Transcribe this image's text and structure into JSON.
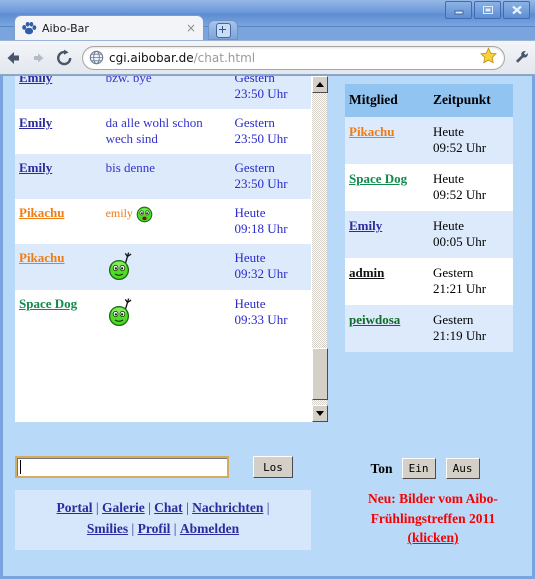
{
  "window": {
    "controls": {
      "minimize": "minimize",
      "maximize": "maximize",
      "close": "close"
    }
  },
  "browser": {
    "tab": {
      "title": "Aibo-Bar",
      "favicon": "paw-print-icon",
      "close_label": "×"
    },
    "new_tab_label": "+",
    "toolbar": {
      "back": "back-arrow-icon",
      "forward": "forward-arrow-icon",
      "reload": "reload-icon",
      "url_host": "cgi.aibobar.de",
      "url_path": "/chat.html",
      "url_icon": "globe-icon",
      "bookmark": "star-icon",
      "wrench": "wrench-icon"
    }
  },
  "chat": {
    "messages": [
      {
        "user": "Emily",
        "user_color": "#2b2b9e",
        "text": "bzw. bye",
        "smiley": "",
        "day": "Gestern",
        "time": "23:50 Uhr"
      },
      {
        "user": "Emily",
        "user_color": "#2b2b9e",
        "text": "da alle wohl schon wech sind",
        "smiley": "",
        "day": "Gestern",
        "time": "23:50 Uhr"
      },
      {
        "user": "Emily",
        "user_color": "#2b2b9e",
        "text": "bis denne",
        "smiley": "",
        "day": "Gestern",
        "time": "23:50 Uhr"
      },
      {
        "user": "Pikachu",
        "user_color": "#f07c14",
        "text": "emily",
        "smiley": "shocked-green-smiley",
        "day": "Heute",
        "time": "09:18 Uhr"
      },
      {
        "user": "Pikachu",
        "user_color": "#f07c14",
        "text": "",
        "smiley": "waving-green-smiley",
        "day": "Heute",
        "time": "09:32 Uhr"
      },
      {
        "user": "Space Dog",
        "user_color": "#0f8a4a",
        "text": "",
        "smiley": "waving-green-smiley",
        "day": "Heute",
        "time": "09:33 Uhr"
      }
    ],
    "scrollbar": {
      "up": "scroll-up-arrow-icon",
      "down": "scroll-down-arrow-icon"
    }
  },
  "members": {
    "headers": {
      "name": "Mitglied",
      "time": "Zeitpunkt"
    },
    "rows": [
      {
        "name": "Pikachu",
        "color": "#f07c14",
        "day": "Heute",
        "time": "09:52 Uhr"
      },
      {
        "name": "Space Dog",
        "color": "#0f8a4a",
        "day": "Heute",
        "time": "09:52 Uhr"
      },
      {
        "name": "Emily",
        "color": "#2b2b9e",
        "day": "Heute",
        "time": "00:05 Uhr"
      },
      {
        "name": "admin",
        "color": "#111111",
        "day": "Gestern",
        "time": "21:21 Uhr"
      },
      {
        "name": "peiwdosa",
        "color": "#0f6b2a",
        "day": "Gestern",
        "time": "21:19 Uhr"
      }
    ]
  },
  "form": {
    "input_value": "",
    "input_placeholder": "",
    "submit_label": "Los"
  },
  "nav": {
    "line1": [
      "Portal",
      "Galerie",
      "Chat",
      "Nachrichten"
    ],
    "line2": [
      "Smilies",
      "Profil",
      "Abmelden"
    ],
    "separator": "|"
  },
  "sound": {
    "label": "Ton",
    "on_label": "Ein",
    "off_label": "Aus"
  },
  "promo": {
    "line1": "Neu: Bilder vom Aibo-",
    "line2": "Frühlingstreffen 2011",
    "link": "(klicken)"
  },
  "colors": {
    "page_background": "#b9d9f9",
    "row_odd": "#ddeafb",
    "row_even": "#ffffff",
    "member_header": "#92c4f2",
    "promo_red": "#f80000",
    "input_border": "#d4ab5f"
  }
}
